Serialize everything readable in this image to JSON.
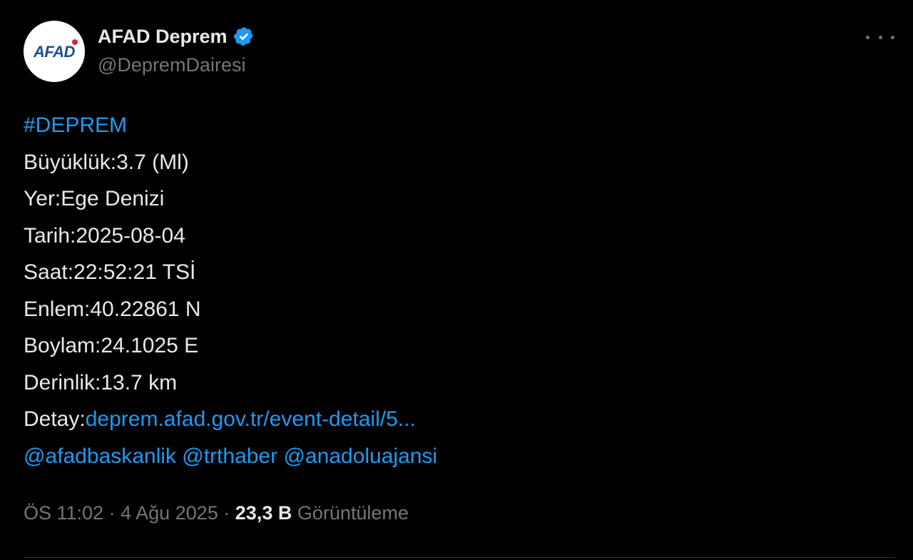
{
  "author": {
    "avatar_text": "AFAD",
    "display_name": "AFAD Deprem",
    "handle": "@DepremDairesi",
    "verified_color": "#1d9bf0"
  },
  "tweet": {
    "hashtag": "#DEPREM",
    "lines": [
      "Büyüklük:3.7 (Ml)",
      "Yer:Ege Denizi",
      "Tarih:2025-08-04",
      "Saat:22:52:21 TSİ",
      "Enlem:40.22861 N",
      "Boylam:24.1025 E",
      "Derinlik:13.7 km"
    ],
    "detail_label": "Detay:",
    "detail_link": "deprem.afad.gov.tr/event-detail/5...",
    "mentions": [
      "@afadbaskanlik",
      "@trthaber",
      "@anadoluajansi"
    ]
  },
  "meta": {
    "time": "ÖS 11:02",
    "date": "4 Ağu 2025",
    "separator": "·",
    "views_count": "23,3 B",
    "views_label": "Görüntüleme"
  },
  "colors": {
    "background": "#000000",
    "text": "#e7e9ea",
    "muted": "#71767b",
    "link": "#1d9bf0"
  }
}
